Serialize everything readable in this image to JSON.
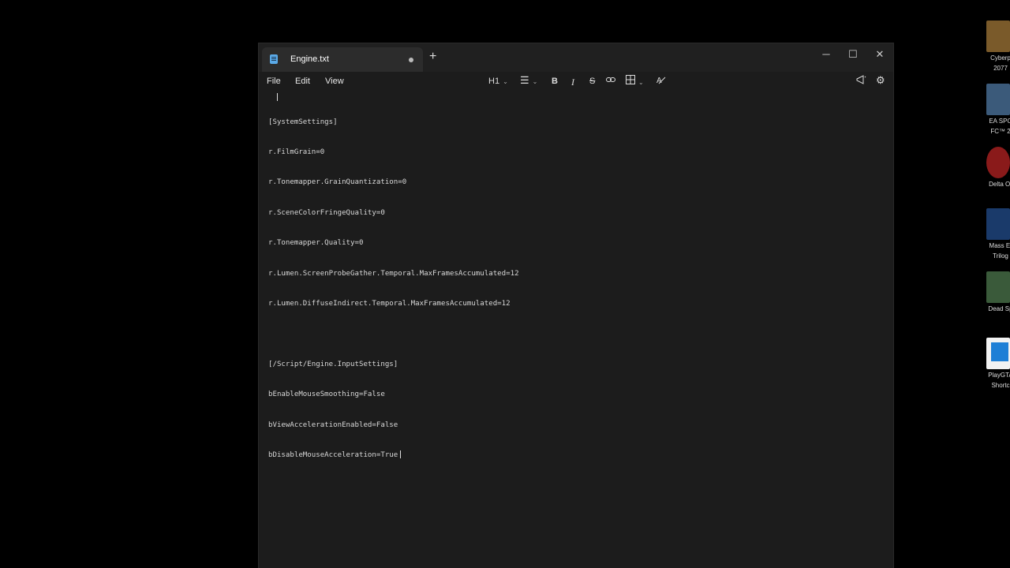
{
  "desktop": {
    "icons": [
      {
        "label_line1": "Cyberp",
        "label_line2": "2077",
        "color": "#7a5a2a"
      },
      {
        "label_line1": "EA SPO",
        "label_line2": "FC™ 2",
        "color": "#3b5a7a"
      },
      {
        "label_line1": "Delta Or",
        "label_line2": "",
        "color": "#8a1a1a"
      },
      {
        "label_line1": "Mass Ef",
        "label_line2": "Trilog",
        "color": "#1a3a6a"
      },
      {
        "label_line1": "Dead Sp",
        "label_line2": "",
        "color": "#3a5a3a"
      },
      {
        "label_line1": "PlayGTA",
        "label_line2": "Shortc",
        "color": "#1e7fd6"
      }
    ]
  },
  "window": {
    "tab_title": "Engine.txt",
    "tab_unsaved_dot": "●",
    "new_tab": "+",
    "controls": {
      "minimize": "─",
      "maximize": "☐",
      "close": "✕"
    },
    "menu": {
      "file": "File",
      "edit": "Edit",
      "view": "View"
    },
    "toolbar": {
      "heading": "H1",
      "bold": "B",
      "italic": "I",
      "strike": "S"
    }
  },
  "editor": {
    "lines": [
      "[SystemSettings]",
      "r.FilmGrain=0",
      "r.Tonemapper.GrainQuantization=0",
      "r.SceneColorFringeQuality=0",
      "r.Tonemapper.Quality=0",
      "r.Lumen.ScreenProbeGather.Temporal.MaxFramesAccumulated=12",
      "r.Lumen.DiffuseIndirect.Temporal.MaxFramesAccumulated=12",
      "",
      "[/Script/Engine.InputSettings]",
      "bEnableMouseSmoothing=False",
      "bViewAccelerationEnabled=False",
      "bDisableMouseAcceleration=True"
    ]
  }
}
